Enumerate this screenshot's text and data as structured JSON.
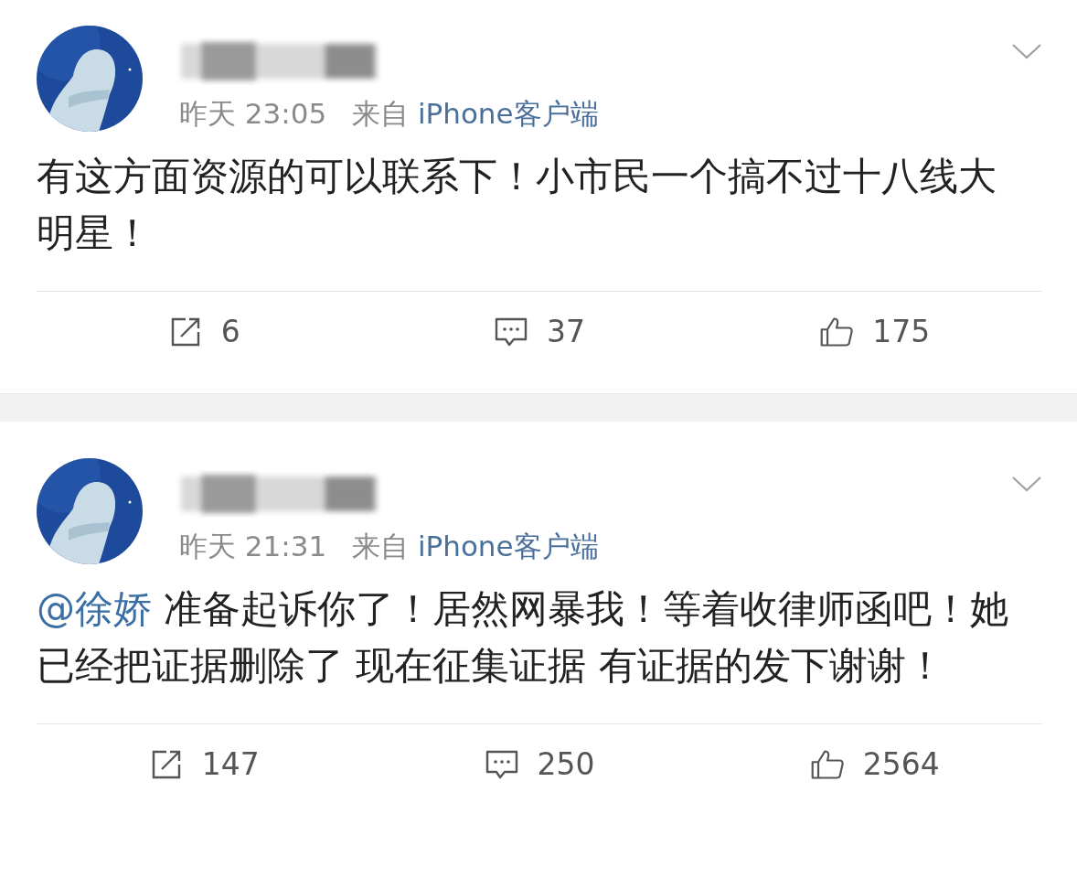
{
  "posts": [
    {
      "time": "昨天 23:05",
      "source_prefix": "来自",
      "source": "iPhone客户端",
      "text": "有这方面资源的可以联系下！小市民一个搞不过十八线大明星！",
      "actions": [
        {
          "kind": "repost",
          "count": "6"
        },
        {
          "kind": "comment",
          "count": "37"
        },
        {
          "kind": "like",
          "count": "175"
        }
      ]
    },
    {
      "time": "昨天 21:31",
      "source_prefix": "来自",
      "source": "iPhone客户端",
      "mention": "@徐娇",
      "text": " 准备起诉你了！居然网暴我！等着收律师函吧！她已经把证据删除了 现在征集证据 有证据的发下谢谢！",
      "actions": [
        {
          "kind": "repost",
          "count": "147"
        },
        {
          "kind": "comment",
          "count": "250"
        },
        {
          "kind": "like",
          "count": "2564"
        }
      ]
    }
  ]
}
